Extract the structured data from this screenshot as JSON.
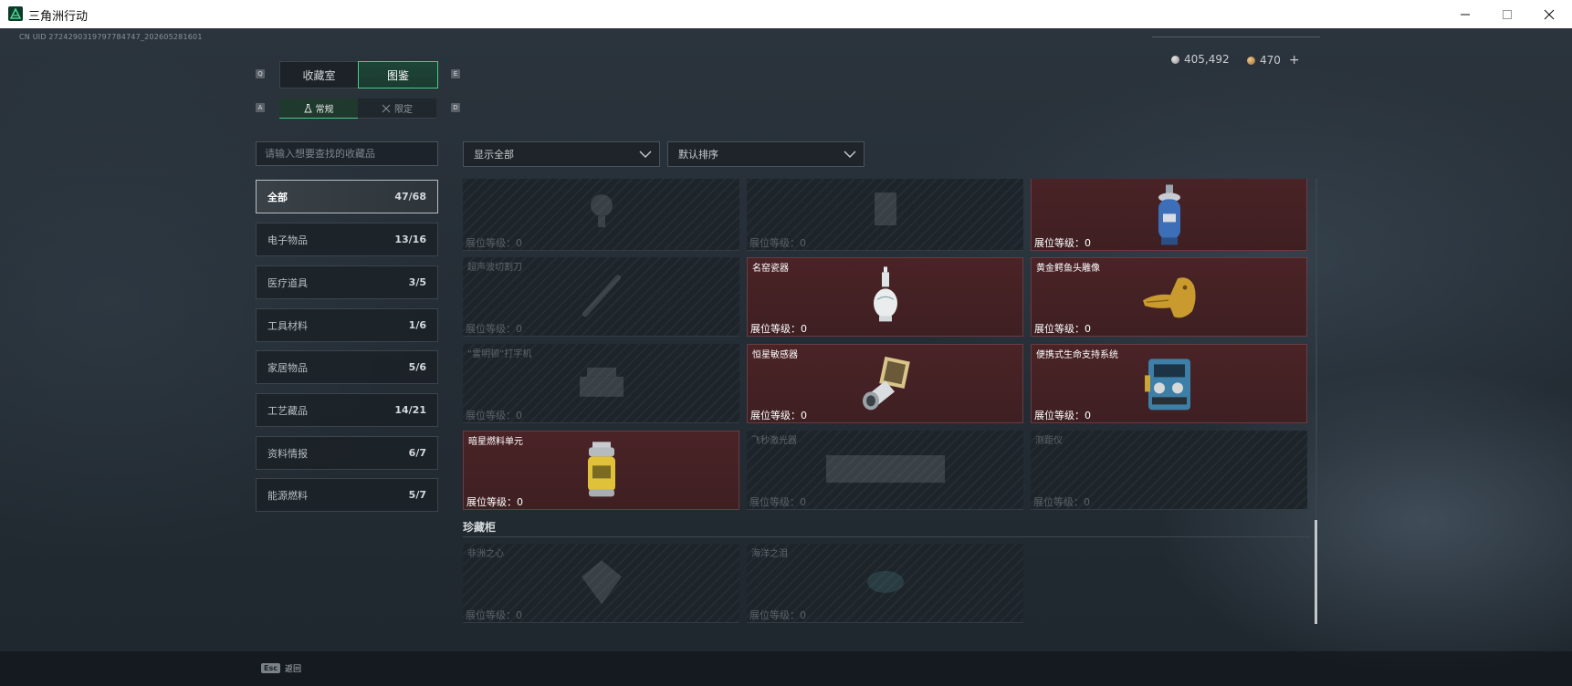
{
  "window": {
    "title": "三角洲行动",
    "icon": "delta-logo-icon"
  },
  "header": {
    "uid": "CN UID 2724290319797784747_202605281601",
    "currency": [
      {
        "name": "silver-coin",
        "value": "405,492",
        "color": "#c8c8c8"
      },
      {
        "name": "gold-coin",
        "value": "470",
        "color": "#d9a45e"
      }
    ],
    "plus_label": "+"
  },
  "tabs": {
    "left_key": "Q",
    "right_key": "E",
    "items": [
      {
        "label": "收藏室",
        "active": false
      },
      {
        "label": "图鉴",
        "active": true
      }
    ]
  },
  "subtabs": {
    "left_key": "A",
    "right_key": "D",
    "items": [
      {
        "label": "常规",
        "icon": "flask-icon",
        "active": true
      },
      {
        "label": "限定",
        "icon": "crossed-swords-icon",
        "active": false
      }
    ]
  },
  "search": {
    "placeholder": "请输入想要查找的收藏品",
    "value": ""
  },
  "categories": [
    {
      "name": "全部",
      "count": "47/68",
      "active": true
    },
    {
      "name": "电子物品",
      "count": "13/16",
      "active": false
    },
    {
      "name": "医疗道具",
      "count": "3/5",
      "active": false
    },
    {
      "name": "工具材料",
      "count": "1/6",
      "active": false
    },
    {
      "name": "家居物品",
      "count": "5/6",
      "active": false
    },
    {
      "name": "工艺藏品",
      "count": "14/21",
      "active": false
    },
    {
      "name": "资料情报",
      "count": "6/7",
      "active": false
    },
    {
      "name": "能源燃料",
      "count": "5/7",
      "active": false
    }
  ],
  "filters": {
    "show": {
      "value": "显示全部"
    },
    "sort": {
      "value": "默认排序"
    }
  },
  "grid": {
    "level_label": "展位等级：0",
    "items": [
      {
        "name": "",
        "owned": false,
        "art": "lamp"
      },
      {
        "name": "",
        "owned": false,
        "art": "box"
      },
      {
        "name": "",
        "owned": true,
        "art": "gas-tank"
      },
      {
        "name": "超声波切割刀",
        "owned": false,
        "art": "knife"
      },
      {
        "name": "名窑瓷器",
        "owned": true,
        "art": "vase"
      },
      {
        "name": "黄金鳄鱼头雕像",
        "owned": true,
        "art": "croc"
      },
      {
        "name": "“雷明顿”打字机",
        "owned": false,
        "art": "typewriter"
      },
      {
        "name": "恒星敏感器",
        "owned": true,
        "art": "sensor"
      },
      {
        "name": "便携式生命支持系统",
        "owned": true,
        "art": "life"
      },
      {
        "name": "暗星燃料单元",
        "owned": true,
        "art": "fuel"
      },
      {
        "name": "飞秒激光器",
        "owned": false,
        "art": "laser"
      },
      {
        "name": "测距仪",
        "owned": false,
        "art": "none"
      }
    ]
  },
  "vault": {
    "title": "珍藏柜",
    "items": [
      {
        "name": "非洲之心",
        "owned": false,
        "art": "gem"
      },
      {
        "name": "海洋之泪",
        "owned": false,
        "art": "tear"
      }
    ]
  },
  "footer": {
    "esc_key": "Esc",
    "esc_label": "返回"
  }
}
